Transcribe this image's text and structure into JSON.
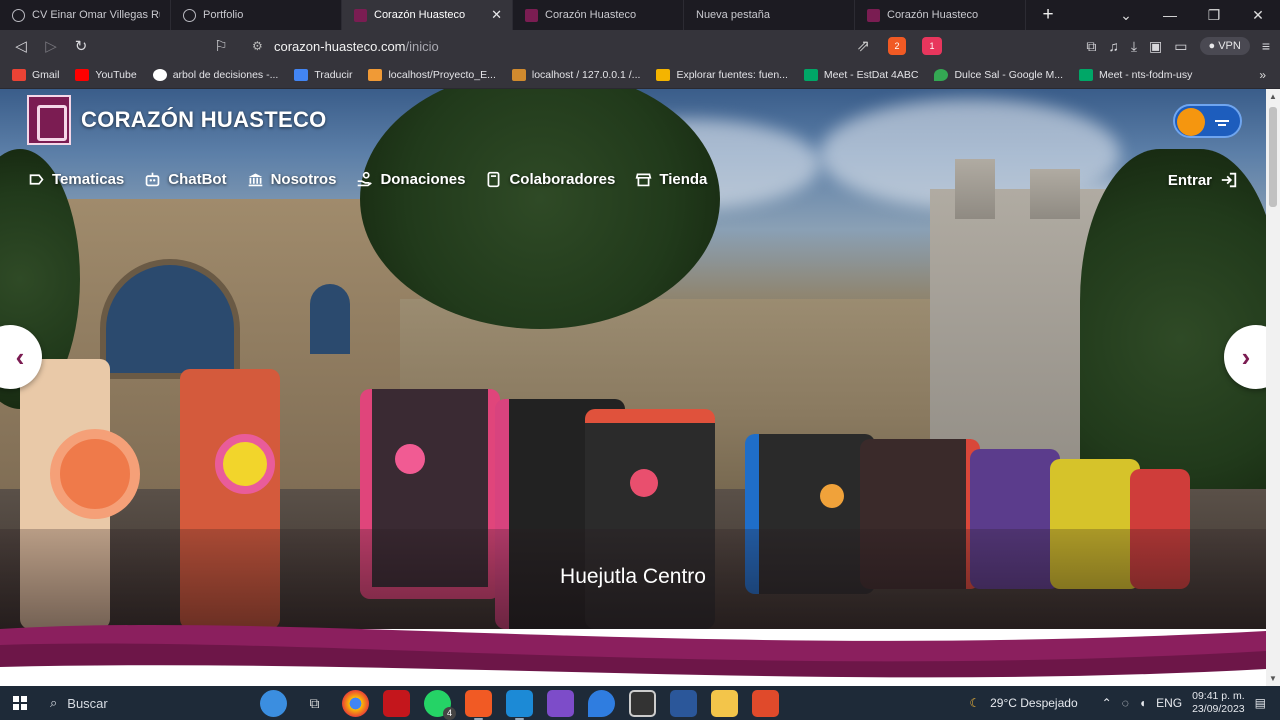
{
  "browser": {
    "tabs": [
      {
        "title": "CV Einar Omar Villegas Ruiz.pdf",
        "active": false,
        "icon": "globe-icon"
      },
      {
        "title": "Portfolio",
        "active": false,
        "icon": "globe-icon"
      },
      {
        "title": "Corazón Huasteco",
        "active": true,
        "icon": "site-logo-icon"
      },
      {
        "title": "Corazón Huasteco",
        "active": false,
        "icon": "site-logo-icon"
      },
      {
        "title": "Nueva pestaña",
        "active": false,
        "icon": ""
      },
      {
        "title": "Corazón Huasteco",
        "active": false,
        "icon": "site-logo-icon"
      }
    ],
    "url": {
      "domain": "corazon-huasteco.com",
      "path": "/inicio"
    },
    "vpn_label": "VPN",
    "shield_count": "2",
    "alert_count": "1",
    "bookmarks": [
      {
        "label": "Gmail",
        "color": "#ea4335"
      },
      {
        "label": "YouTube",
        "color": "#ff0000"
      },
      {
        "label": "arbol de decisiones -...",
        "color": "#ffffff"
      },
      {
        "label": "Traducir",
        "color": "#4285f4"
      },
      {
        "label": "localhost/Proyecto_E...",
        "color": "#f09a36"
      },
      {
        "label": "localhost / 127.0.0.1 /...",
        "color": "#d08a2e"
      },
      {
        "label": "Explorar fuentes: fuen...",
        "color": "#f4b400"
      },
      {
        "label": "Meet - EstDat 4ABC",
        "color": "#00a767"
      },
      {
        "label": "Dulce Sal - Google M...",
        "color": "#34a853"
      },
      {
        "label": "Meet - nts-fodm-usy",
        "color": "#00a767"
      }
    ]
  },
  "site": {
    "brand": "CORAZÓN HUASTECO",
    "menu": [
      {
        "label": "Tematicas",
        "icon": "tag-icon"
      },
      {
        "label": "ChatBot",
        "icon": "robot-icon"
      },
      {
        "label": "Nosotros",
        "icon": "institution-icon"
      },
      {
        "label": "Donaciones",
        "icon": "donate-icon"
      },
      {
        "label": "Colaboradores",
        "icon": "id-badge-icon"
      },
      {
        "label": "Tienda",
        "icon": "store-icon"
      }
    ],
    "login": "Entrar",
    "carousel_caption": "Huejutla Centro",
    "accent_color": "#7b1c52"
  },
  "taskbar": {
    "search_label": "Buscar",
    "weather": "29°C  Despejado",
    "language": "ENG",
    "time": "09:41 p. m.",
    "date": "23/09/2023",
    "whatsapp_badge": "4"
  }
}
